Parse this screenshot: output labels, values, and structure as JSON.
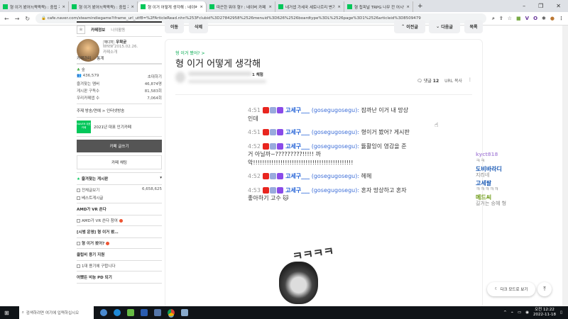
{
  "browser": {
    "tabs": [
      {
        "label": "형 이거 봤어?(짝짝짝) : 중립 게시"
      },
      {
        "label": "형 이거 봤어?(짝짝짝) : 중립 게시"
      },
      {
        "label": "형 이거 어떻게 생각해 : 네이버"
      },
      {
        "label": "따끈한 뭐야 형? : 네이버 카페"
      },
      {
        "label": "네거셉 가세국 세토나르리 변기"
      },
      {
        "label": "형 칩피널 TRPG 나무 칸 어시인"
      }
    ],
    "new_tab": "+",
    "url": "cafe.naver.com/steamindiegame?iframe_url_utf8=%2FArticleRead.nhn%253Fclubid%3D27842958%2526menuid%3D626%2526boardtype%3DL%2526page%3D1%2526articleid%3D8509479",
    "extensions": [
      "V",
      "O"
    ]
  },
  "sidebar": {
    "tab_info": "카페정보",
    "tab_activity": "나의활동",
    "manager_badge": "매니저",
    "manager_name": "우왁굳",
    "since": "since 2015.02.26.",
    "intro": "카페소개",
    "manage": "카페관리",
    "stats": "통계",
    "grade": "숲",
    "members": "436,579",
    "invite": "초대하기",
    "stat_rows": [
      {
        "label": "즐겨찾는 멤버",
        "value": "46,874명"
      },
      {
        "label": "게시판 구독수",
        "value": "81,583회"
      },
      {
        "label": "우리카페앱 수",
        "value": "7,064회"
      }
    ],
    "topic": "주제 방송/연예 > 인터넷방송",
    "award_badge": "NAVER 대표카페",
    "award": "2021년 대표 인기카페",
    "write": "카페 글쓰기",
    "chat": "카페 채팅",
    "fav_boards": "즐겨찾는 게시판",
    "boards": [
      {
        "type": "sub",
        "label": "전체글보기",
        "count": "6,658,625"
      },
      {
        "type": "sub",
        "label": "베스트게시글"
      },
      {
        "type": "head",
        "label": "AMD가 VR 쏜다"
      },
      {
        "type": "sub",
        "label": "AMD가 VR 쏜다 참여",
        "new": true
      },
      {
        "type": "head",
        "label": "[시범 운영] 형 이거 봤…"
      },
      {
        "type": "sub",
        "label": "형 이거 봤어?",
        "new": true
      },
      {
        "type": "head",
        "label": "클립비 용기 지원"
      },
      {
        "type": "sub",
        "label": "1대 용기에 구합니다"
      },
      {
        "type": "head",
        "label": "어쨌든 비능 PD 되기"
      }
    ]
  },
  "toolbar": {
    "move": "이동",
    "delete": "삭제",
    "prev": "이전글",
    "next": "다음글",
    "list": "목록"
  },
  "article": {
    "breadcrumb": "형 이거 봤어? >",
    "title": "형 이거 어떻게 생각해",
    "author_grade": "1 체험",
    "comments_label": "댓글",
    "comments_count": "12",
    "url_copy": "URL 복사"
  },
  "chat": [
    {
      "time": "4:51",
      "nick": "고세구___",
      "id": "(gosegugosegu):",
      "text": "잠까난 이거 내 망상인데"
    },
    {
      "time": "4:51",
      "nick": "고세구___",
      "id": "(gosegugosegu):",
      "text": "형이거 봤어? 게시판"
    },
    {
      "time": "4:52",
      "nick": "고세구___",
      "id": "(gosegugosegu):",
      "text": "뜛활잉이 영감을 준거 아닐까~?????????!!!!! 까악!!!!!!!!!!!!!!!!!!!!!!!!!!!!!!!!!!!!!!!!!!!!"
    },
    {
      "time": "4:52",
      "nick": "고세구___",
      "id": "(gosegugosegu):",
      "text": "헤헤"
    },
    {
      "time": "4:53",
      "nick": "고세구___",
      "id": "(gosegugosegu):",
      "text": "혼자 망상하고 혼자 좋아하기 고수"
    }
  ],
  "image_text": "ㅋㅋㅋㅋㅋ",
  "side_chat": [
    {
      "nick": "kyct818",
      "msg": "ㅋㅋ"
    },
    {
      "nick": "도비바라디",
      "msg": "지리네"
    },
    {
      "nick": "고세팔",
      "msg": "ㅋㅋㅋㅋㅋ"
    },
    {
      "nick": "메드씨",
      "msg": "길거는 승혜 형"
    }
  ],
  "dark_mode": "다크 모드로 보기",
  "taskbar": {
    "search_placeholder": "검색하려면 여기에 입력하십시오",
    "time": "오전 12:22",
    "date": "2022-11-18"
  },
  "colors": {
    "naver_green": "#03c75a",
    "nick_blue": "#1f5fd6"
  }
}
